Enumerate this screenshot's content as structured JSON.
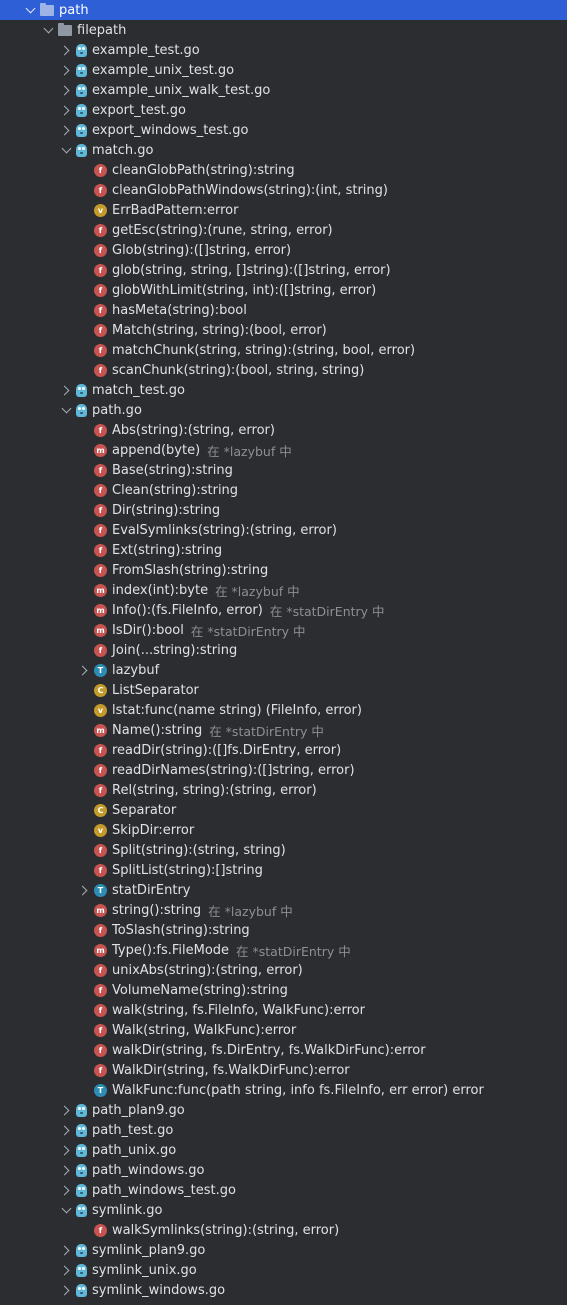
{
  "tree": [
    {
      "label": "path",
      "depth": 0,
      "kind": "folder",
      "chevron": "down",
      "selected": true
    },
    {
      "label": "filepath",
      "depth": 1,
      "kind": "folder",
      "chevron": "down"
    },
    {
      "label": "example_test.go",
      "depth": 2,
      "kind": "go-file",
      "chevron": "right"
    },
    {
      "label": "example_unix_test.go",
      "depth": 2,
      "kind": "go-file",
      "chevron": "right"
    },
    {
      "label": "example_unix_walk_test.go",
      "depth": 2,
      "kind": "go-file",
      "chevron": "right"
    },
    {
      "label": "export_test.go",
      "depth": 2,
      "kind": "go-file",
      "chevron": "right"
    },
    {
      "label": "export_windows_test.go",
      "depth": 2,
      "kind": "go-file",
      "chevron": "right"
    },
    {
      "label": "match.go",
      "depth": 2,
      "kind": "go-file",
      "chevron": "down"
    },
    {
      "label": "cleanGlobPath(string):string",
      "depth": 3,
      "kind": "f"
    },
    {
      "label": "cleanGlobPathWindows(string):(int, string)",
      "depth": 3,
      "kind": "f"
    },
    {
      "label": "ErrBadPattern:error",
      "depth": 3,
      "kind": "v"
    },
    {
      "label": "getEsc(string):(rune, string, error)",
      "depth": 3,
      "kind": "f"
    },
    {
      "label": "Glob(string):([]string, error)",
      "depth": 3,
      "kind": "f"
    },
    {
      "label": "glob(string, string, []string):([]string, error)",
      "depth": 3,
      "kind": "f"
    },
    {
      "label": "globWithLimit(string, int):([]string, error)",
      "depth": 3,
      "kind": "f"
    },
    {
      "label": "hasMeta(string):bool",
      "depth": 3,
      "kind": "f"
    },
    {
      "label": "Match(string, string):(bool, error)",
      "depth": 3,
      "kind": "f"
    },
    {
      "label": "matchChunk(string, string):(string, bool, error)",
      "depth": 3,
      "kind": "f"
    },
    {
      "label": "scanChunk(string):(bool, string, string)",
      "depth": 3,
      "kind": "f"
    },
    {
      "label": "match_test.go",
      "depth": 2,
      "kind": "go-file",
      "chevron": "right"
    },
    {
      "label": "path.go",
      "depth": 2,
      "kind": "go-file",
      "chevron": "down"
    },
    {
      "label": "Abs(string):(string, error)",
      "depth": 3,
      "kind": "f"
    },
    {
      "label": "append(byte)",
      "depth": 3,
      "kind": "m",
      "hint": "在 *lazybuf 中"
    },
    {
      "label": "Base(string):string",
      "depth": 3,
      "kind": "f"
    },
    {
      "label": "Clean(string):string",
      "depth": 3,
      "kind": "f"
    },
    {
      "label": "Dir(string):string",
      "depth": 3,
      "kind": "f"
    },
    {
      "label": "EvalSymlinks(string):(string, error)",
      "depth": 3,
      "kind": "f"
    },
    {
      "label": "Ext(string):string",
      "depth": 3,
      "kind": "f"
    },
    {
      "label": "FromSlash(string):string",
      "depth": 3,
      "kind": "f"
    },
    {
      "label": "index(int):byte",
      "depth": 3,
      "kind": "m",
      "hint": "在 *lazybuf 中"
    },
    {
      "label": "Info():(fs.FileInfo, error)",
      "depth": 3,
      "kind": "m",
      "hint": "在 *statDirEntry 中"
    },
    {
      "label": "IsDir():bool",
      "depth": 3,
      "kind": "m",
      "hint": "在 *statDirEntry 中"
    },
    {
      "label": "Join(...string):string",
      "depth": 3,
      "kind": "f"
    },
    {
      "label": "lazybuf",
      "depth": 3,
      "kind": "t",
      "chevron": "right"
    },
    {
      "label": "ListSeparator",
      "depth": 3,
      "kind": "c"
    },
    {
      "label": "lstat:func(name string) (FileInfo, error)",
      "depth": 3,
      "kind": "v"
    },
    {
      "label": "Name():string",
      "depth": 3,
      "kind": "m",
      "hint": "在 *statDirEntry 中"
    },
    {
      "label": "readDir(string):([]fs.DirEntry, error)",
      "depth": 3,
      "kind": "f"
    },
    {
      "label": "readDirNames(string):([]string, error)",
      "depth": 3,
      "kind": "f"
    },
    {
      "label": "Rel(string, string):(string, error)",
      "depth": 3,
      "kind": "f"
    },
    {
      "label": "Separator",
      "depth": 3,
      "kind": "c"
    },
    {
      "label": "SkipDir:error",
      "depth": 3,
      "kind": "v"
    },
    {
      "label": "Split(string):(string, string)",
      "depth": 3,
      "kind": "f"
    },
    {
      "label": "SplitList(string):[]string",
      "depth": 3,
      "kind": "f"
    },
    {
      "label": "statDirEntry",
      "depth": 3,
      "kind": "t",
      "chevron": "right"
    },
    {
      "label": "string():string",
      "depth": 3,
      "kind": "m",
      "hint": "在 *lazybuf 中"
    },
    {
      "label": "ToSlash(string):string",
      "depth": 3,
      "kind": "f"
    },
    {
      "label": "Type():fs.FileMode",
      "depth": 3,
      "kind": "m",
      "hint": "在 *statDirEntry 中"
    },
    {
      "label": "unixAbs(string):(string, error)",
      "depth": 3,
      "kind": "f"
    },
    {
      "label": "VolumeName(string):string",
      "depth": 3,
      "kind": "f"
    },
    {
      "label": "walk(string, fs.FileInfo, WalkFunc):error",
      "depth": 3,
      "kind": "f"
    },
    {
      "label": "Walk(string, WalkFunc):error",
      "depth": 3,
      "kind": "f"
    },
    {
      "label": "walkDir(string, fs.DirEntry, fs.WalkDirFunc):error",
      "depth": 3,
      "kind": "f"
    },
    {
      "label": "WalkDir(string, fs.WalkDirFunc):error",
      "depth": 3,
      "kind": "f"
    },
    {
      "label": "WalkFunc:func(path string, info fs.FileInfo, err error) error",
      "depth": 3,
      "kind": "t"
    },
    {
      "label": "path_plan9.go",
      "depth": 2,
      "kind": "go-file",
      "chevron": "right"
    },
    {
      "label": "path_test.go",
      "depth": 2,
      "kind": "go-file",
      "chevron": "right"
    },
    {
      "label": "path_unix.go",
      "depth": 2,
      "kind": "go-file",
      "chevron": "right"
    },
    {
      "label": "path_windows.go",
      "depth": 2,
      "kind": "go-file",
      "chevron": "right"
    },
    {
      "label": "path_windows_test.go",
      "depth": 2,
      "kind": "go-file",
      "chevron": "right"
    },
    {
      "label": "symlink.go",
      "depth": 2,
      "kind": "go-file",
      "chevron": "down"
    },
    {
      "label": "walkSymlinks(string):(string, error)",
      "depth": 3,
      "kind": "f"
    },
    {
      "label": "symlink_plan9.go",
      "depth": 2,
      "kind": "go-file",
      "chevron": "right"
    },
    {
      "label": "symlink_unix.go",
      "depth": 2,
      "kind": "go-file",
      "chevron": "right"
    },
    {
      "label": "symlink_windows.go",
      "depth": 2,
      "kind": "go-file",
      "chevron": "right"
    }
  ],
  "icon_letters": {
    "f": "f",
    "m": "m",
    "v": "v",
    "t": "T",
    "c": "C"
  },
  "colors": {
    "background": "#2b2d30",
    "selection": "#2e5fd7",
    "function": "#c75450",
    "variable": "#c39a2b",
    "type": "#2d8cb3",
    "go_file": "#5fb7d9"
  }
}
